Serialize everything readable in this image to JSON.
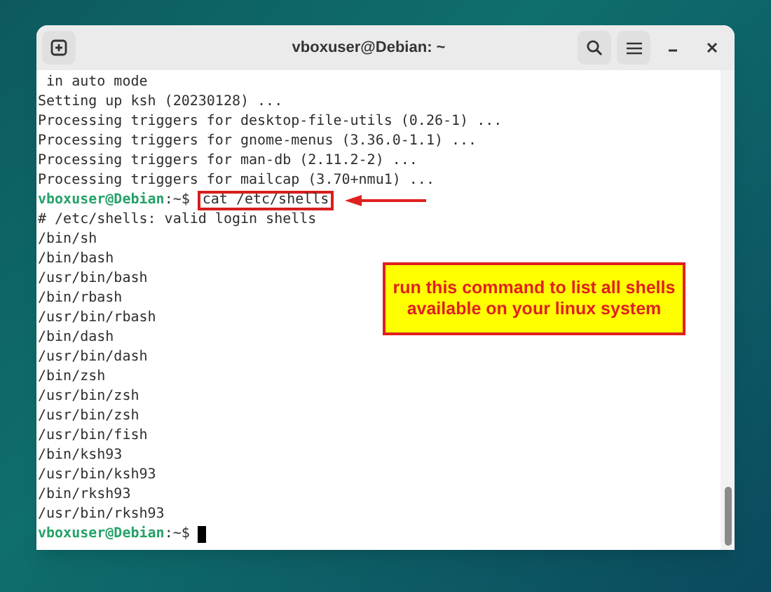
{
  "window": {
    "title": "vboxuser@Debian: ~"
  },
  "terminal": {
    "lines": [
      {
        "kind": "output",
        "text": " in auto mode"
      },
      {
        "kind": "output",
        "text": "Setting up ksh (20230128) ..."
      },
      {
        "kind": "output",
        "text": "Processing triggers for desktop-file-utils (0.26-1) ..."
      },
      {
        "kind": "output",
        "text": "Processing triggers for gnome-menus (3.36.0-1.1) ..."
      },
      {
        "kind": "output",
        "text": "Processing triggers for man-db (2.11.2-2) ..."
      },
      {
        "kind": "output",
        "text": "Processing triggers for mailcap (3.70+nmu1) ..."
      },
      {
        "kind": "prompt",
        "user": "vboxuser@Debian",
        "path": ":~$",
        "command": "cat /etc/shells",
        "highlighted": true,
        "cursor": false
      },
      {
        "kind": "output",
        "text": "# /etc/shells: valid login shells"
      },
      {
        "kind": "output",
        "text": "/bin/sh"
      },
      {
        "kind": "output",
        "text": "/bin/bash"
      },
      {
        "kind": "output",
        "text": "/usr/bin/bash"
      },
      {
        "kind": "output",
        "text": "/bin/rbash"
      },
      {
        "kind": "output",
        "text": "/usr/bin/rbash"
      },
      {
        "kind": "output",
        "text": "/bin/dash"
      },
      {
        "kind": "output",
        "text": "/usr/bin/dash"
      },
      {
        "kind": "output",
        "text": "/bin/zsh"
      },
      {
        "kind": "output",
        "text": "/usr/bin/zsh"
      },
      {
        "kind": "output",
        "text": "/usr/bin/zsh"
      },
      {
        "kind": "output",
        "text": "/usr/bin/fish"
      },
      {
        "kind": "output",
        "text": "/bin/ksh93"
      },
      {
        "kind": "output",
        "text": "/usr/bin/ksh93"
      },
      {
        "kind": "output",
        "text": "/bin/rksh93"
      },
      {
        "kind": "output",
        "text": "/usr/bin/rksh93"
      },
      {
        "kind": "prompt",
        "user": "vboxuser@Debian",
        "path": ":~$",
        "highlighted": false,
        "cursor": true
      }
    ]
  },
  "annotation": {
    "text": "run this command to list all shells available on your linux system"
  }
}
